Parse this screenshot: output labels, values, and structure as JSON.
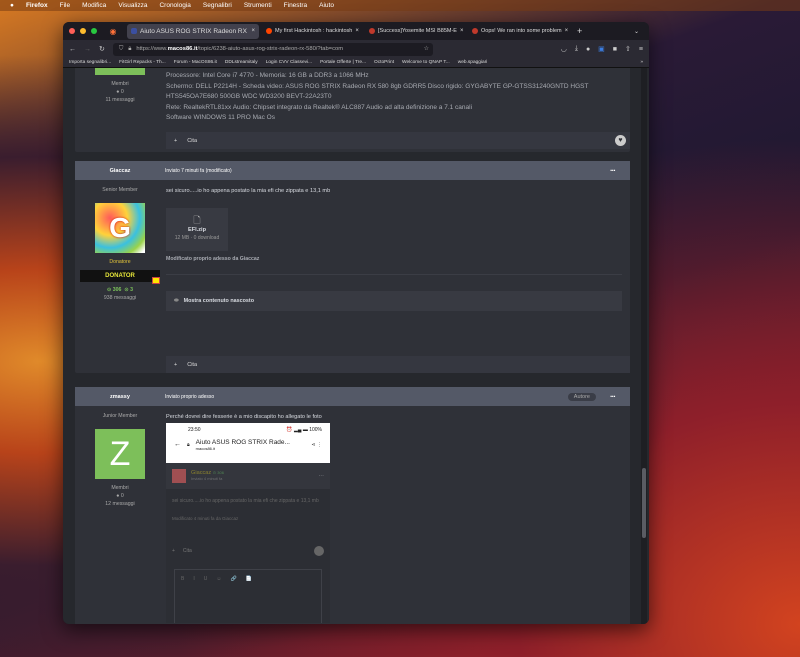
{
  "menubar": {
    "items": [
      "Firefox",
      "File",
      "Modifica",
      "Visualizza",
      "Cronologia",
      "Segnalibri",
      "Strumenti",
      "Finestra",
      "Aiuto"
    ]
  },
  "tabs": [
    {
      "label": "Aiuto ASUS ROG STRIX Radeon RX",
      "color": "#3b4fa0"
    },
    {
      "label": "My first Hackintosh : hackintosh",
      "color": "#ff4500"
    },
    {
      "label": "[Success]Yosemite MSI B85M-E",
      "color": "#c0392b"
    },
    {
      "label": "Oops! We ran into some problem",
      "color": "#c0392b"
    }
  ],
  "url": {
    "prefix": "https://www.",
    "domain": "macos86.it",
    "path": "/topic/6238-aiuto-asus-rog-strix-radeon-rx-580/?tab=com"
  },
  "bookmarks": [
    "Importa segnalibri...",
    "FitGirl Repacks - Th...",
    "Forum - MacOS86.it",
    "DDLstreamitaly",
    "Login CVV Classevi...",
    "Portale Offerte | Tre...",
    "OctoPrint",
    "Welcome to QNAP T...",
    "web.spaggiari"
  ],
  "post1": {
    "rank": "Membri",
    "rep": "0",
    "posts": "11 messaggi",
    "lines": [
      "Processore:  Intel Core i7 4770 - Memoria:  16 GB a DDR3 a 1066 MHz",
      "Schermo:  DELL P2214H - Scheda video:  ASUS ROG STRIX Radeon RX 580 8gb GDRR5 Disco rigido:    GYGABYTE GP-GTSS31240GNTD HGST",
      "HTS545OA7E680 500GB WDC WD3200 BEVT-22A23T0",
      "Rete: RealtekRTL81xx Audio: Chipset integrato da Realtek® ALC887    Audio ad alta definizione a 7.1 canali",
      "Software    WINDOWS 11 PRO Mac Os"
    ],
    "quote": "Cita"
  },
  "post2": {
    "author": "Giaccaz",
    "date": "Inviato 7 minuti fa (modificato)",
    "rank": "Senior Member",
    "group": "Donatore",
    "badge": "DONATOR",
    "rep": "306",
    "rep2": "3",
    "posts": "938 messaggi",
    "text": "sei sicuro.....io ho appena postato la mia efi che zippata e 13,1 mb",
    "file": {
      "name": "EFI.zip",
      "meta": "12 MB · 0 download"
    },
    "edited": "Modificato proprio adesso da Giaccaz",
    "hidden": "Mostra contenuto nascosto",
    "quote": "Cita"
  },
  "post3": {
    "author": "zmassy",
    "date": "Inviato proprio adesso",
    "tag": "Autore",
    "rank": "Junior Member",
    "avatar_letter": "Z",
    "group": "Membri",
    "rep": "0",
    "posts": "12 messaggi",
    "text": "Perché dovrei dire fesserie è a mio discapito ho allegato le foto",
    "shot": {
      "time": "23:50",
      "battery": "100%",
      "title": "Aiuto ASUS ROG STRIX Rade...",
      "domain": "macos86.it",
      "author": "Giaccaz",
      "rep": "306",
      "date": "Inviato 4 minuti fa",
      "text": "sei sicuro.....io ho appena postato la mia efi che zippata e 13,1 mb",
      "edited": "Modificato 4 minuti fa da Giaccaz",
      "quote": "Cita",
      "toolbar": [
        "B",
        "I",
        "U",
        "☺",
        "🔗",
        "📄"
      ]
    }
  }
}
